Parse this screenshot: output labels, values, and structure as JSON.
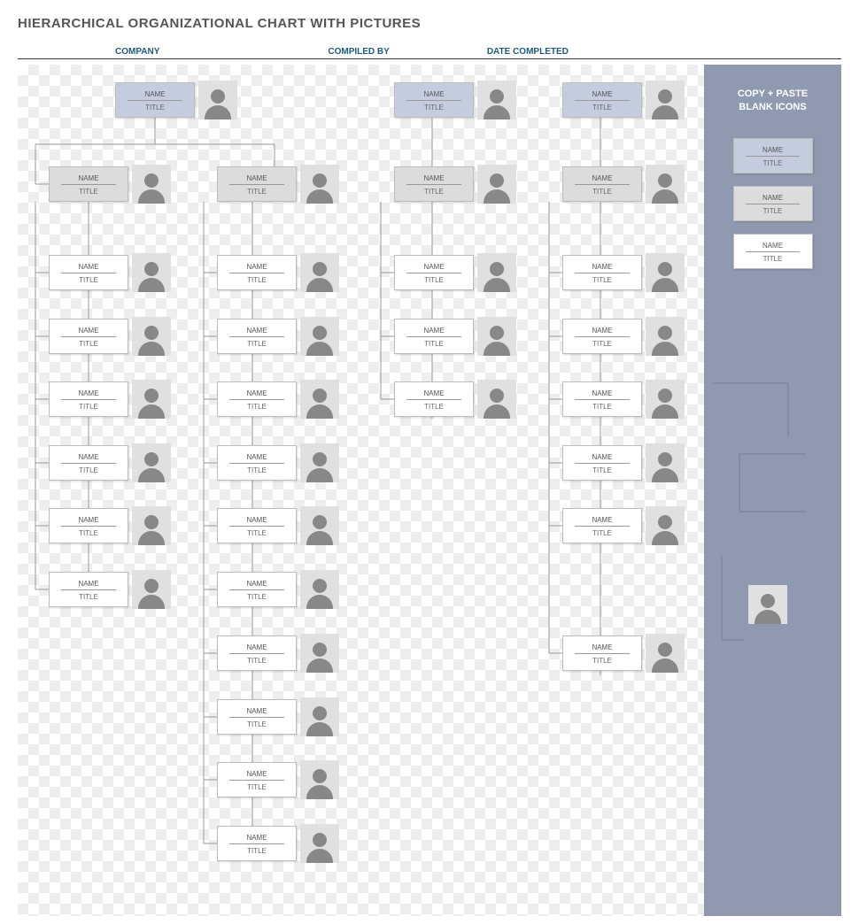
{
  "title": "HIERARCHICAL ORGANIZATIONAL CHART WITH PICTURES",
  "header": {
    "company": "COMPANY",
    "compiled": "COMPILED BY",
    "completed": "DATE COMPLETED"
  },
  "sidebar": {
    "title1": "COPY + PASTE",
    "title2": "BLANK ICONS",
    "cards": [
      {
        "name": "NAME",
        "title": "TITLE"
      },
      {
        "name": "NAME",
        "title": "TITLE"
      },
      {
        "name": "NAME",
        "title": "TITLE"
      }
    ]
  },
  "label": {
    "name": "NAME",
    "title": "TITLE"
  }
}
